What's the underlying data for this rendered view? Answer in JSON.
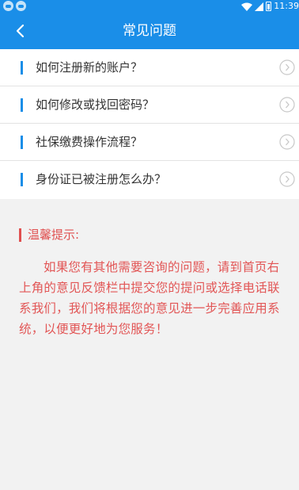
{
  "status_bar": {
    "time": "11:39"
  },
  "header": {
    "title": "常见问题"
  },
  "faq": {
    "items": [
      {
        "label": "如何注册新的账户？"
      },
      {
        "label": "如何修改或找回密码？"
      },
      {
        "label": "社保缴费操作流程？"
      },
      {
        "label": "身份证已被注册怎么办？"
      }
    ]
  },
  "tip": {
    "title": "温馨提示:",
    "body": "如果您有其他需要咨询的问题，请到首页右上角的意见反馈栏中提交您的提问或选择电话联系我们，我们将根据您的意见进一步完善应用系统，以便更好地为您服务！"
  },
  "colors": {
    "accent": "#1a8ee8",
    "tip_red": "#e05050",
    "background": "#f2f2f2"
  }
}
